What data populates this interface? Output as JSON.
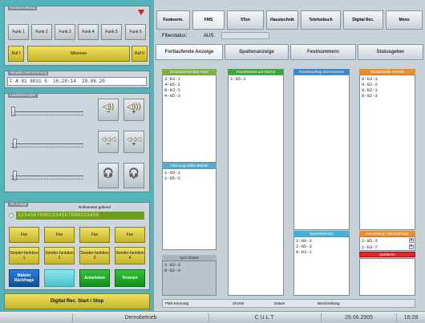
{
  "funk": {
    "title": "Funkvermittlung",
    "buttons": [
      "Funk 1",
      "Funk 2",
      "Funk 3",
      "Funk 4",
      "Funk 5",
      "Funk 6"
    ],
    "ruf_left": "Ruf I",
    "ruf_mid": "Mitsenen",
    "ruf_right": "Ruf II"
  },
  "fms": {
    "title": "Aktuelle FMS-Kennung",
    "value": "F A 81 8031 5  16:28:14  29.06.20"
  },
  "laut": {
    "title": "Lautstärkeregler"
  },
  "tk": {
    "title": "TK-Anlage",
    "ruf": "Rufnummer gehend",
    "number": "12345678901234567890123456",
    "fax": [
      "Fax",
      "Fax",
      "Fax",
      "Fax"
    ],
    "sonder": [
      "Sonder-funktion 1",
      "Sonder-funktion 2",
      "Sonder-funktion 3",
      "Sonder-funktion 4"
    ],
    "makeln": "Makeln Rückfrage",
    "blank": "",
    "annehmen": "Annehmen",
    "trennen": "Trennen"
  },
  "digital": "Digital Rec. Start / Stop",
  "top_tabs": [
    "Funkverm.",
    "FMS",
    "5Ton",
    "Haustechnik",
    "Telefonbuch",
    "Digital Rec.",
    "Menu"
  ],
  "filter": {
    "label": "Filterstatus:",
    "value": "AUS"
  },
  "main_tabs": [
    "Fortlaufende Anzeige",
    "Spaltenanzeige",
    "Festnummern",
    "Statusgeber"
  ],
  "col1": {
    "head": "Einsatzbereit über Funk",
    "items": [
      "3-83-1",
      "4-85-2",
      "8-83-3",
      "4-85-3"
    ],
    "head2": "Fahrzeug außer Betrieb",
    "items2": [
      "1-85-1",
      "1-85-3"
    ],
    "head3": "Sprechtaste",
    "items3": [
      "1-83-3",
      "8-82-3"
    ]
  },
  "col2": {
    "head": "Einsatzbereit auf Wache",
    "items": [
      "1-85-2"
    ]
  },
  "col3": {
    "head": "Einsatzauftrag übernommen",
    "items": [],
    "head2": "Sprechwunsch",
    "items2": [
      "1-86-3",
      "2-85-3",
      "8-83-1"
    ]
  },
  "col4": {
    "head": "Einsatzstelle erreicht",
    "items": [
      "8-83-1",
      "8-82-2",
      "8-82-1",
      "8-82-3"
    ],
    "head2": "Anmeldung / Wachabfrage",
    "items2": [
      "2-85-3",
      "1-83-7"
    ],
    "quit": "Quittieren"
  },
  "bottom_labels": [
    "FMS-Kennung",
    "Uhrzeit",
    "Datum",
    "Beschreibung"
  ],
  "statusbar": {
    "mode": "Demobetrieb",
    "brand": "CULT",
    "date": "29.06.2005",
    "time": "16:28"
  }
}
